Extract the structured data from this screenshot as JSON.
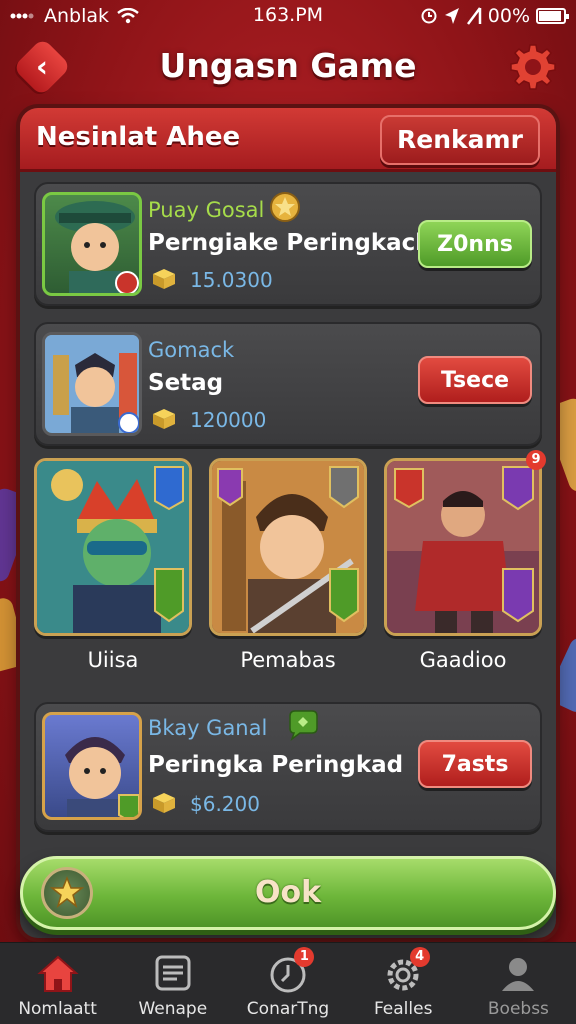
{
  "status_bar": {
    "carrier": "Anblak",
    "time": "163.PM",
    "battery": "00%",
    "battery_level": 0.9
  },
  "header": {
    "title": "Ungasn Game",
    "back_icon": "chevron-left-icon",
    "settings_icon": "gear-icon"
  },
  "panel": {
    "title": "Nesinlat Ahee",
    "rank_button": "Renkamr"
  },
  "rows": [
    {
      "name": "Puay Gosal",
      "name_color": "#a6dc4a",
      "subtitle": "Perngiake Peringkack",
      "amount": "15.0300",
      "action": "Z0nns",
      "action_style": "green"
    },
    {
      "name": "Gomack",
      "name_color": "#7ab8e6",
      "subtitle": "Setag",
      "amount": "120000",
      "action": "Tsece",
      "action_style": "red"
    },
    {
      "name": "Bkay Ganal",
      "name_color": "#7ab8e6",
      "subtitle": "Peringka Peringkad",
      "amount": "$6.200",
      "action": "7asts",
      "action_style": "red"
    }
  ],
  "characters": [
    {
      "label": "Uiisa"
    },
    {
      "label": "Pemabas"
    },
    {
      "label": "Gaadioo",
      "badge": "9"
    }
  ],
  "ok_button": {
    "label": "Ook"
  },
  "bottom_nav": [
    {
      "label": "Nomlaatt",
      "icon": "home-icon"
    },
    {
      "label": "Wenape",
      "icon": "menu-list-icon"
    },
    {
      "label": "ConarTng",
      "icon": "clock-icon",
      "badge": "1"
    },
    {
      "label": "Fealles",
      "icon": "cogwheel-icon",
      "badge": "4"
    },
    {
      "label": "Boebss",
      "icon": "profile-icon"
    }
  ],
  "colors": {
    "background": "#b01e22",
    "panel": "#3b3b3d",
    "accent_red": "#c93a34",
    "accent_green": "#6db63a",
    "amount_blue": "#7ab8e6"
  }
}
